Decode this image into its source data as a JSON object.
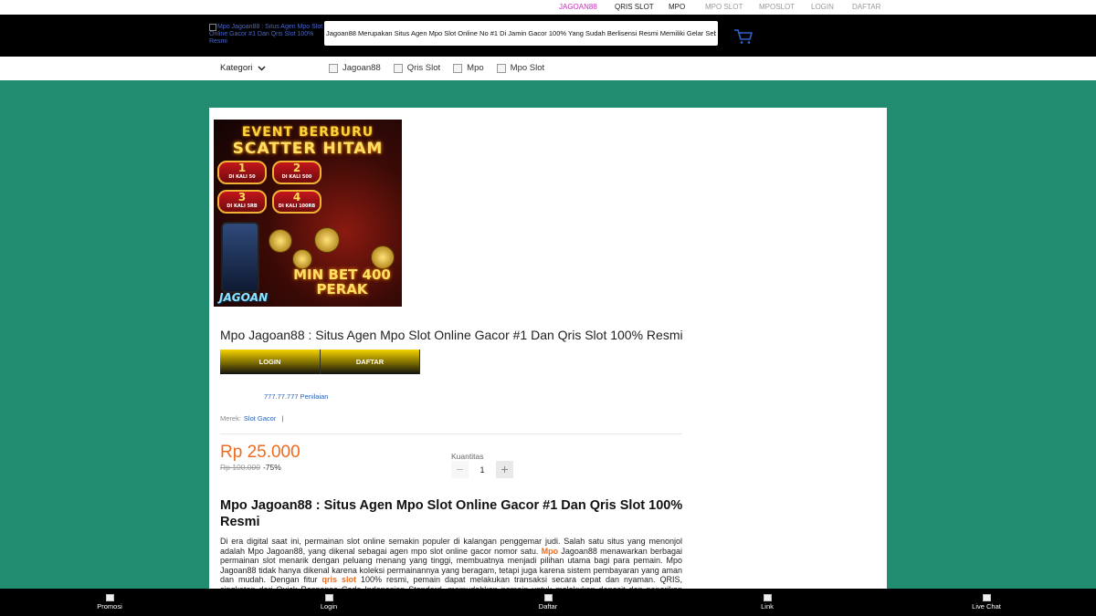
{
  "toplinks": [
    {
      "label": "JAGOAN88",
      "color": "#c634b9"
    },
    {
      "label": "QRIS SLOT",
      "color": "#222222"
    },
    {
      "label": "MPO",
      "color": "#222222"
    },
    {
      "label": "MPO SLOT",
      "color": "#999999"
    },
    {
      "label": "MPOSLOT",
      "color": "#999999"
    },
    {
      "label": "LOGIN",
      "color": "#999999"
    },
    {
      "label": "DAFTAR",
      "color": "#999999"
    }
  ],
  "header": {
    "logo_alt": "Mpo Jagoan88 : Situs Agen Mpo Slot Online Gacor #1 Dan Qris Slot 100% Resmi",
    "search_value": "Jagoan88 Merupakan Situs Agen Mpo Slot Online No #1 Di Jamin Gacor 100% Yang Sudah Berlisensi Resmi Memiliki Gelar Sebagai",
    "cart_icon": "cart-icon"
  },
  "nav": {
    "kategori": "Kategori",
    "links": [
      "Jagoan88",
      "Qris Slot",
      "Mpo",
      "Mpo Slot"
    ]
  },
  "banner": {
    "line1": "EVENT BERBURU",
    "line2": "SCATTER HITAM",
    "badges": [
      {
        "num": "1",
        "sub": "DI KALI 50"
      },
      {
        "num": "2",
        "sub": "DI KALI 500"
      },
      {
        "num": "3",
        "sub": "DI KALI 5RB"
      },
      {
        "num": "4",
        "sub": "DI KALI 100RB"
      }
    ],
    "minbet": "MIN BET 400 PERAK",
    "brand": "JAGOAN"
  },
  "product": {
    "title": "Mpo Jagoan88 : Situs Agen Mpo Slot Online Gacor #1 Dan Qris Slot 100% Resmi",
    "login_label": "LOGIN",
    "daftar_label": "DAFTAR",
    "rating": "777.77.777 Penilaian",
    "brand_label": "Merek:",
    "brand_value": "Slot Gacor",
    "brand_sep": "|",
    "price": "Rp 25.000",
    "old_price": "Rp 100.000",
    "discount": "-75%",
    "qty_label": "Kuantitas",
    "qty_value": "1",
    "accent": "#ef6b1f"
  },
  "article": {
    "heading": "Mpo Jagoan88 : Situs Agen Mpo Slot Online Gacor #1 Dan Qris Slot 100% Resmi",
    "p1": "Di era digital saat ini, permainan slot online semakin populer di kalangan penggemar judi. Salah satu situs yang menonjol adalah Mpo Jagoan88, yang dikenal sebagai agen mpo slot online gacor nomor satu. ",
    "link1": "Mpo",
    "p2": " Jagoan88 menawarkan berbagai permainan slot menarik dengan peluang menang yang tinggi, membuatnya menjadi pilihan utama bagi para pemain. Mpo Jagoan88 tidak hanya dikenal karena koleksi permainannya yang beragam, tetapi juga karena sistem pembayaran yang aman dan mudah. Dengan fitur ",
    "link2": "qris slot",
    "p3": " 100% resmi, pemain dapat melakukan transaksi secara cepat dan nyaman. QRIS, singkatan dari Quick Response Code Indonesian Standard, memudahkan pemain untuk melakukan deposit dan penarikan tanpa"
  },
  "bottombar": [
    "Promosi",
    "Login",
    "Daftar",
    "Link",
    "Live Chat"
  ],
  "colors": {
    "background": "#218c70",
    "header": "#000000"
  }
}
